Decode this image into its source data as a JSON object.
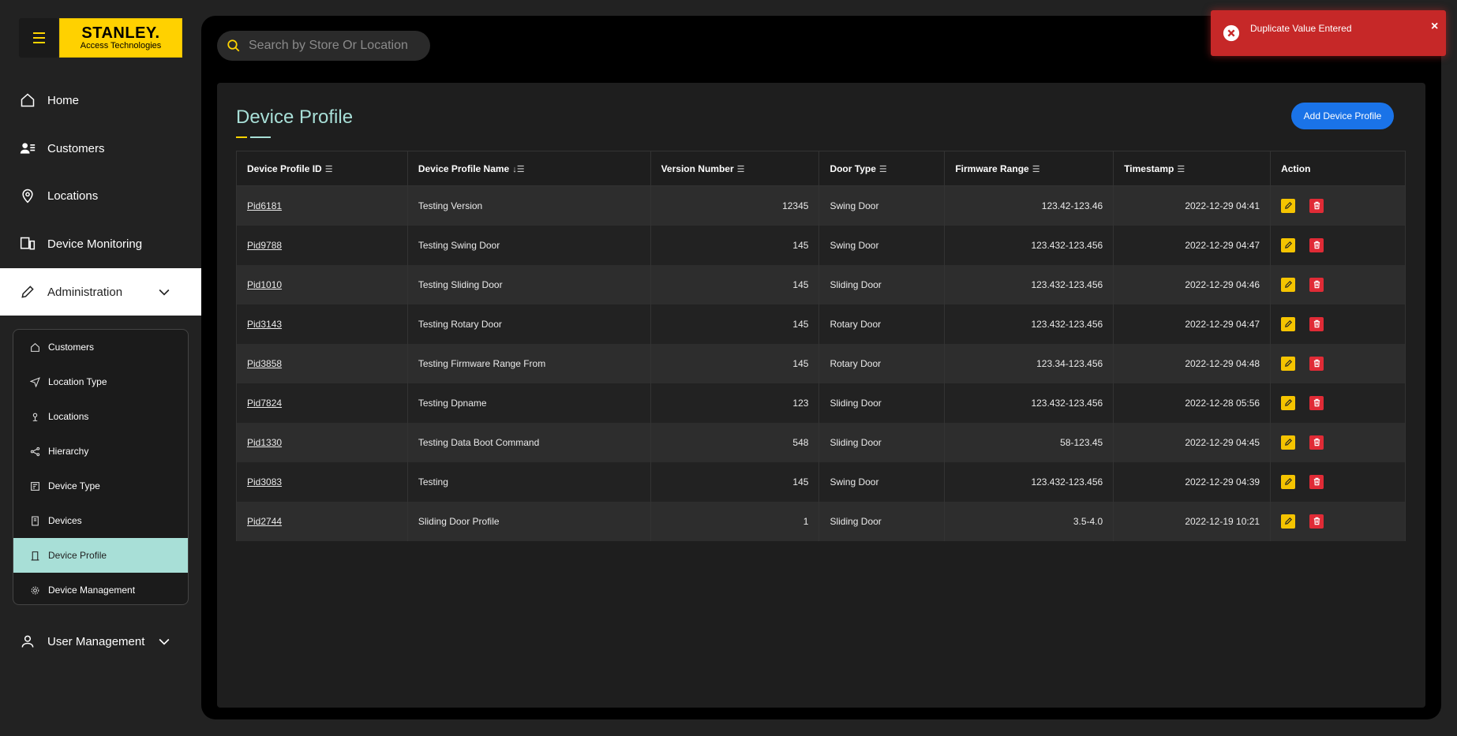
{
  "brand": {
    "line1": "STANLEY.",
    "line2": "Access Technologies"
  },
  "nav": {
    "home": "Home",
    "customers": "Customers",
    "locations": "Locations",
    "device_monitoring": "Device Monitoring",
    "administration": "Administration",
    "user_management": "User Management"
  },
  "submenu": [
    {
      "label": "Customers",
      "icon": "home-icon"
    },
    {
      "label": "Location Type",
      "icon": "send-icon"
    },
    {
      "label": "Locations",
      "icon": "pin-icon"
    },
    {
      "label": "Hierarchy",
      "icon": "share-icon"
    },
    {
      "label": "Device Type",
      "icon": "device-type-icon"
    },
    {
      "label": "Devices",
      "icon": "device-icon"
    },
    {
      "label": "Device Profile",
      "icon": "door-icon",
      "active": true
    },
    {
      "label": "Device Management",
      "icon": "gear-icon"
    }
  ],
  "search": {
    "placeholder": "Search by Store Or Location"
  },
  "page": {
    "title": "Device Profile",
    "add_button": "Add Device Profile"
  },
  "table": {
    "columns": [
      "Device Profile ID",
      "Device Profile Name",
      "Version Number",
      "Door Type",
      "Firmware Range",
      "Timestamp",
      "Action"
    ],
    "rows": [
      [
        "Pid6181",
        "Testing Version",
        "12345",
        "Swing Door",
        "123.42-123.46",
        "2022-12-29 04:41"
      ],
      [
        "Pid9788",
        "Testing Swing Door",
        "145",
        "Swing Door",
        "123.432-123.456",
        "2022-12-29 04:47"
      ],
      [
        "Pid1010",
        "Testing Sliding Door",
        "145",
        "Sliding Door",
        "123.432-123.456",
        "2022-12-29 04:46"
      ],
      [
        "Pid3143",
        "Testing Rotary Door",
        "145",
        "Rotary Door",
        "123.432-123.456",
        "2022-12-29 04:47"
      ],
      [
        "Pid3858",
        "Testing Firmware Range From",
        "145",
        "Rotary Door",
        "123.34-123.456",
        "2022-12-29 04:48"
      ],
      [
        "Pid7824",
        "Testing Dpname",
        "123",
        "Sliding Door",
        "123.432-123.456",
        "2022-12-28 05:56"
      ],
      [
        "Pid1330",
        "Testing Data Boot Command",
        "548",
        "Sliding Door",
        "58-123.45",
        "2022-12-29 04:45"
      ],
      [
        "Pid3083",
        "Testing",
        "145",
        "Swing Door",
        "123.432-123.456",
        "2022-12-29 04:39"
      ],
      [
        "Pid2744",
        "Sliding Door Profile",
        "1",
        "Sliding Door",
        "3.5-4.0",
        "2022-12-19 10:21"
      ]
    ]
  },
  "toast": {
    "message": "Duplicate Value Entered",
    "close": "×"
  },
  "colors": {
    "accent": "#ffd400",
    "brand": "#ffd100",
    "teal": "#a8dfd7",
    "primary_button": "#1a73e8",
    "error": "#c62828"
  }
}
